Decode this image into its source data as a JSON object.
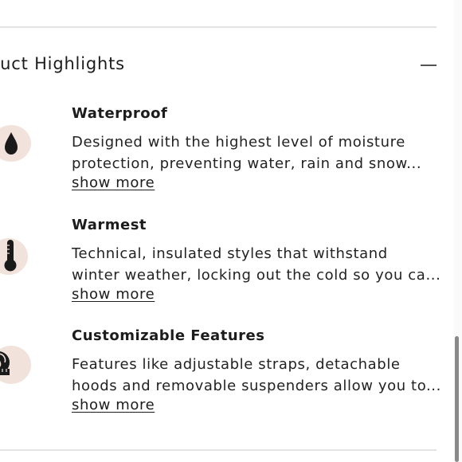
{
  "section": {
    "title": "duct Highlights",
    "toggle_icon": "minus-icon"
  },
  "features": [
    {
      "icon": "water-drop-icon",
      "title": "Waterproof",
      "desc_line1": "Designed with the highest level of moisture",
      "desc_line2": "protection, preventing water, rain and snow...",
      "show_more": "show more"
    },
    {
      "icon": "thermometer-icon",
      "title": "Warmest",
      "desc_line1": "Technical, insulated styles that withstand",
      "desc_line2": "winter weather, locking out the cold so you ca...",
      "show_more": "show more"
    },
    {
      "icon": "measuring-tape-icon",
      "title": "Customizable Features",
      "desc_line1": "Features like adjustable straps, detachable",
      "desc_line2": "hoods and removable suspenders allow you to...",
      "show_more": "show more"
    }
  ],
  "colors": {
    "icon_badge_bg": "#f1e2db",
    "icon_fill": "#1a1a1a",
    "divider": "#e3e3e3",
    "scrollbar_thumb": "#8a8a8a"
  }
}
